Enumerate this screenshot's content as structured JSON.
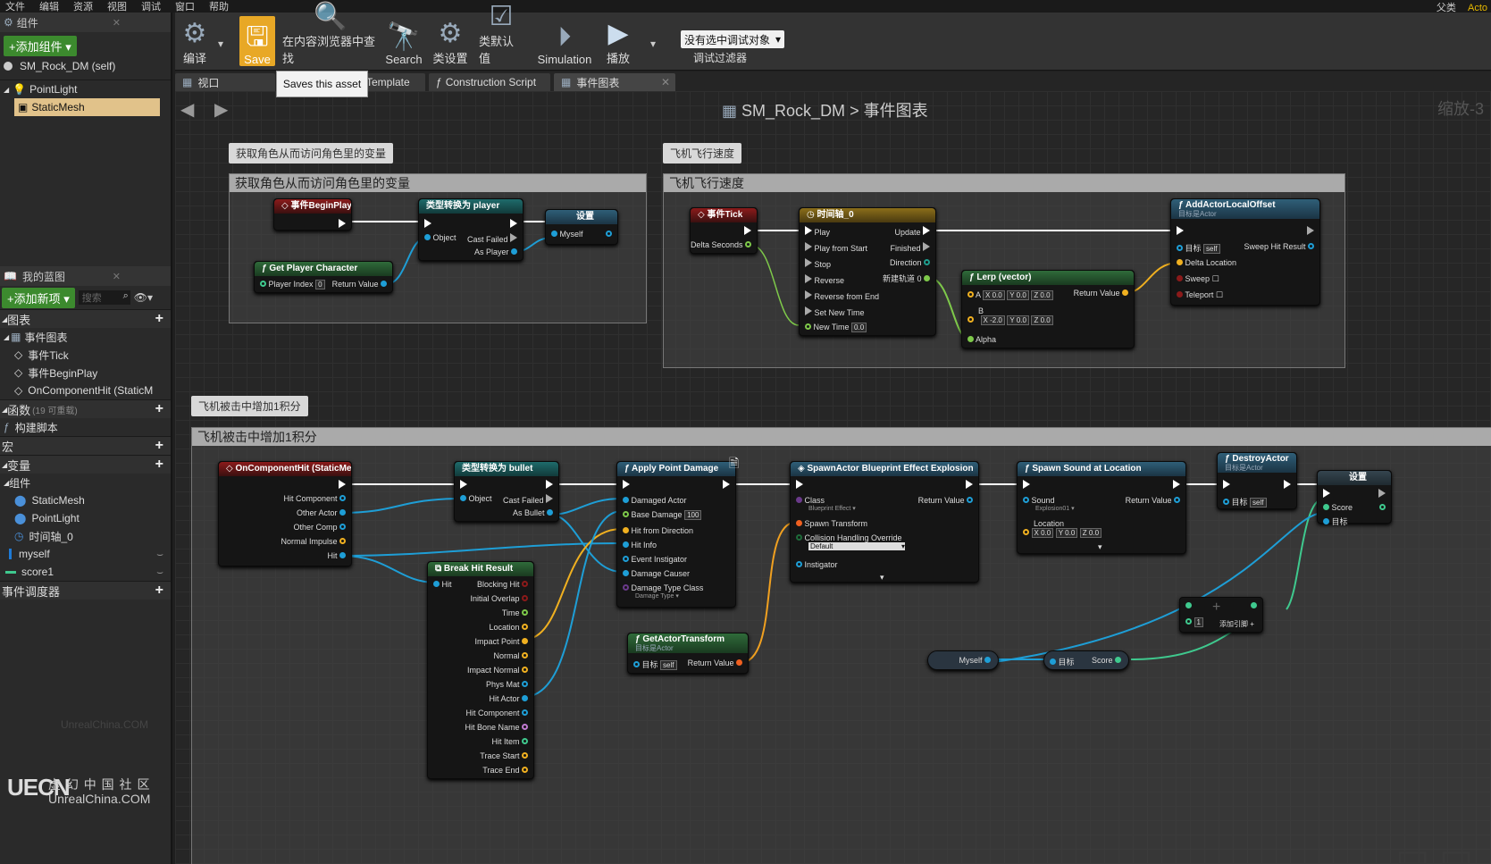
{
  "menu": [
    "文件",
    "编辑",
    "资源",
    "视图",
    "调试",
    "窗口",
    "帮助"
  ],
  "menu_right": {
    "prefix": "父类",
    "suffix": "Acto"
  },
  "components_panel": {
    "tab_label": "组件",
    "add_button": "+添加组件",
    "root": "SM_Rock_DM (self)",
    "items": [
      "PointLight",
      "StaticMesh"
    ]
  },
  "mybp_panel": {
    "tab_label": "我的蓝图",
    "add_button": "+添加新项",
    "search_placeholder": "搜索",
    "graphs_header": "图表",
    "event_graph": "事件图表",
    "events": [
      "事件Tick",
      "事件BeginPlay",
      "OnComponentHit (StaticM"
    ],
    "functions_header": "函数",
    "functions_count": "(19 可重载)",
    "construct": "构建脚本",
    "macros_header": "宏",
    "vars_header": "变量",
    "components_sub": "组件",
    "var_components": [
      "StaticMesh",
      "PointLight",
      "时间轴_0"
    ],
    "vars": [
      "myself",
      "score1"
    ],
    "dispatchers_header": "事件调度器"
  },
  "toolbar": {
    "compile": "编译",
    "save": "Save",
    "find": "在内容浏览器中查找",
    "search": "Search",
    "class_settings": "类设置",
    "class_defaults": "类默认值",
    "simulation": "Simulation",
    "play": "播放",
    "debug_select": "没有选中调试对象",
    "debug_filter": "调试过滤器"
  },
  "tabs": [
    "视口",
    "Template",
    "Construction Script",
    "事件图表"
  ],
  "tooltip": "Saves this asset",
  "breadcrumb": {
    "asset": "SM_Rock_DM",
    "sep": ">",
    "graph": "事件图表"
  },
  "zoom": "缩放-3",
  "comments": {
    "c1": "获取角色从而访问角色里的变量",
    "c2": "飞机飞行速度",
    "c3": "飞机被击中增加1积分"
  },
  "nodes": {
    "beginplay": "事件BeginPlay",
    "cast_player": {
      "title": "类型转换为 player",
      "object": "Object",
      "failed": "Cast Failed",
      "as": "As Player"
    },
    "set1": {
      "title": "设置",
      "pin": "Myself"
    },
    "getplayer": {
      "title": "Get Player Character",
      "index": "Player Index",
      "index_val": "0",
      "ret": "Return Value"
    },
    "tick": {
      "title": "事件Tick",
      "delta": "Delta Seconds"
    },
    "timeline": {
      "title": "时间轴_0",
      "pins_in": [
        "Play",
        "Play from Start",
        "Stop",
        "Reverse",
        "Reverse from End",
        "Set New Time",
        "New Time"
      ],
      "pins_out": [
        "Update",
        "Finished",
        "Direction",
        "新建轨道 0"
      ],
      "newtime": "0.0"
    },
    "lerp": {
      "title": "Lerp (vector)",
      "a": "A",
      "b": "B",
      "alpha": "Alpha",
      "ret": "Return Value",
      "ax": "0.0",
      "ay": "0.0",
      "az": "0.0",
      "bx": "-2.0",
      "by": "0.0",
      "bz": "0.0"
    },
    "addoffset": {
      "title": "AddActorLocalOffset",
      "sub": "目标是Actor",
      "target": "目标",
      "self": "self",
      "delta": "Delta Location",
      "sweep": "Sweep",
      "teleport": "Teleport",
      "hit": "Sweep Hit Result"
    },
    "onhit": {
      "title": "OnComponentHit (StaticMesh)",
      "pins": [
        "Hit Component",
        "Other Actor",
        "Other Comp",
        "Normal Impulse",
        "Hit"
      ]
    },
    "cast_bullet": {
      "title": "类型转换为 bullet",
      "object": "Object",
      "failed": "Cast Failed",
      "as": "As Bullet"
    },
    "breakhit": {
      "title": "Break Hit Result",
      "in": "Hit",
      "pins": [
        "Blocking Hit",
        "Initial Overlap",
        "Time",
        "Location",
        "Impact Point",
        "Normal",
        "Impact Normal",
        "Phys Mat",
        "Hit Actor",
        "Hit Component",
        "Hit Bone Name",
        "Hit Item",
        "Trace Start",
        "Trace End"
      ]
    },
    "applydmg": {
      "title": "Apply Point Damage",
      "pins": [
        "Damaged Actor",
        "Base Damage",
        "Hit from Direction",
        "Hit Info",
        "Event Instigator",
        "Damage Causer",
        "Damage Type Class"
      ],
      "base": "100",
      "dtype": "Damage Type ▾"
    },
    "gettransform": {
      "title": "GetActorTransform",
      "sub": "目标是Actor",
      "target": "目标",
      "self": "self",
      "ret": "Return Value"
    },
    "spawnactor": {
      "title": "SpawnActor Blueprint Effect Explosion",
      "class": "Class",
      "class_val": "Blueprint Effect ▾",
      "transform": "Spawn Transform",
      "collision": "Collision Handling Override",
      "coll_val": "Default",
      "instigator": "Instigator",
      "ret": "Return Value"
    },
    "spawnsound": {
      "title": "Spawn Sound at Location",
      "sound": "Sound",
      "sound_val": "Explosion01 ▾",
      "location": "Location",
      "lx": "0.0",
      "ly": "0.0",
      "lz": "0.0",
      "ret": "Return Value"
    },
    "destroy": {
      "title": "DestroyActor",
      "sub": "目标是Actor",
      "target": "目标",
      "self": "self"
    },
    "set2": {
      "title": "设置",
      "score": "Score",
      "target": "目标"
    },
    "add": {
      "val": "1",
      "label": "添加引脚 +"
    },
    "myself_get": "Myself",
    "score_get": {
      "target": "目标",
      "score": "Score"
    }
  },
  "watermark": {
    "logo": "UECN",
    "cn": "虚 幻 中 国 社 区",
    "en": "UnrealChina.COM",
    "faint": "UnrealChina.COM"
  }
}
